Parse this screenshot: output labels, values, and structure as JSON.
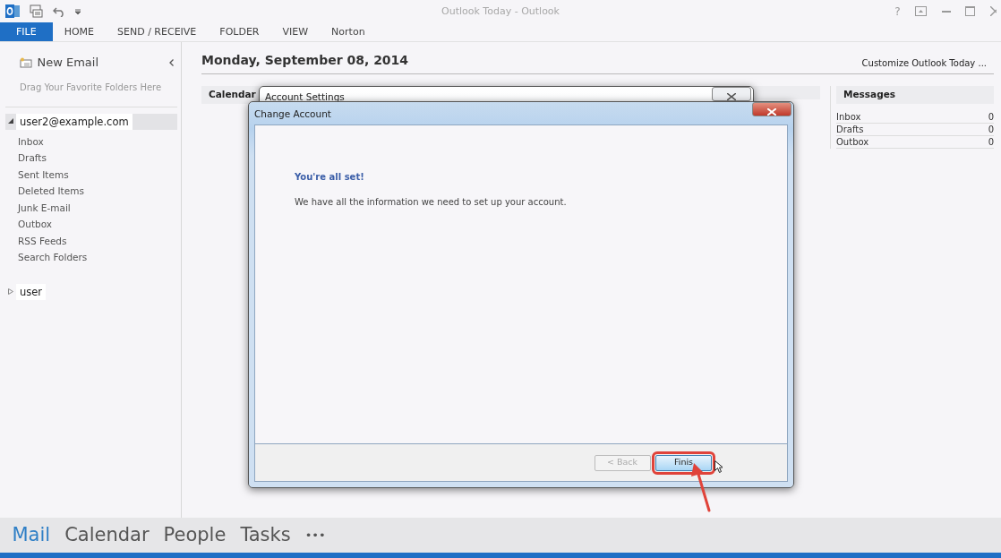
{
  "window": {
    "title": "Outlook Today - Outlook",
    "help": "?"
  },
  "ribbon_tabs": [
    {
      "label": "FILE",
      "selected": true
    },
    {
      "label": "HOME",
      "selected": false
    },
    {
      "label": "SEND / RECEIVE",
      "selected": false
    },
    {
      "label": "FOLDER",
      "selected": false
    },
    {
      "label": "VIEW",
      "selected": false
    },
    {
      "label": "Norton",
      "selected": false
    }
  ],
  "sidebar": {
    "new_email": "New Email",
    "favorites_hint": "Drag Your Favorite Folders Here",
    "accounts": [
      {
        "name": "user2@example.com",
        "expanded": true,
        "selected": true,
        "children": [
          {
            "label": "Inbox"
          },
          {
            "label": "Drafts"
          },
          {
            "label": "Sent Items"
          },
          {
            "label": "Deleted Items"
          },
          {
            "label": "Junk E-mail"
          },
          {
            "label": "Outbox"
          },
          {
            "label": "RSS Feeds"
          },
          {
            "label": "Search Folders"
          }
        ]
      },
      {
        "name": "user",
        "expanded": false,
        "selected": false
      }
    ]
  },
  "today": {
    "date": "Monday, September 08, 2014",
    "customize_link": "Customize Outlook Today ...",
    "calendar_heading": "Calendar",
    "messages_heading": "Messages",
    "messages": [
      {
        "label": "Inbox",
        "count": "0"
      },
      {
        "label": "Drafts",
        "count": "0"
      },
      {
        "label": "Outbox",
        "count": "0"
      }
    ]
  },
  "account_settings_dialog": {
    "title": "Account Settings"
  },
  "change_account_dialog": {
    "title": "Change Account",
    "heading": "You're all set!",
    "message": "We have all the information we need to set up your account.",
    "buttons": [
      {
        "label": "< Back",
        "disabled": true,
        "highlighted": false
      },
      {
        "label": "Finis",
        "disabled": false,
        "highlighted": true
      }
    ]
  },
  "bottom_nav": [
    {
      "label": "Mail",
      "selected": true
    },
    {
      "label": "Calendar",
      "selected": false
    },
    {
      "label": "People",
      "selected": false
    },
    {
      "label": "Tasks",
      "selected": false
    },
    {
      "label": "•••",
      "selected": false
    }
  ]
}
